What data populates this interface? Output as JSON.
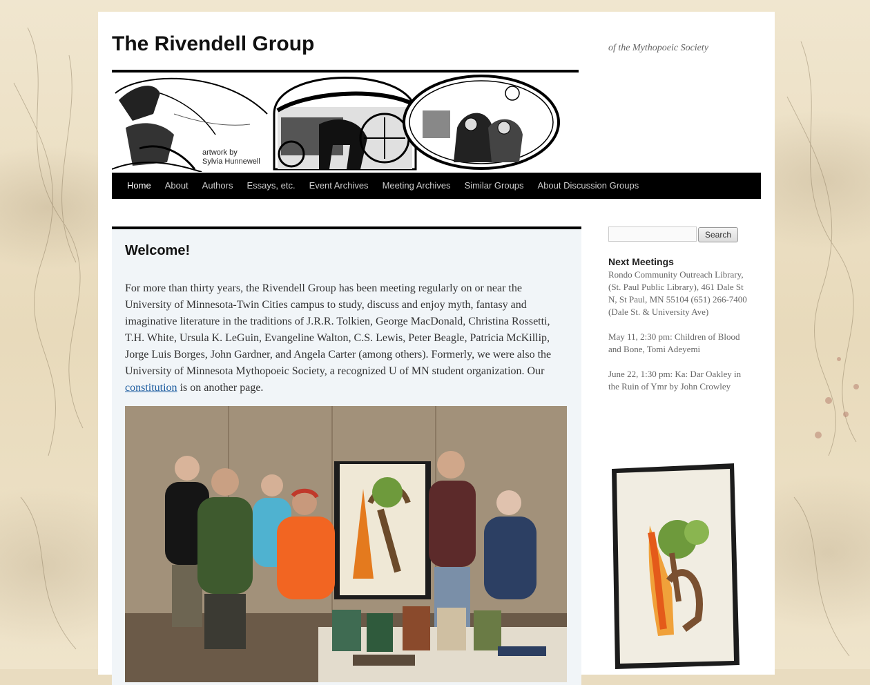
{
  "site": {
    "title": "The Rivendell Group",
    "tagline": "of the Mythopoeic Society",
    "art_credit_line1": "artwork by",
    "art_credit_line2": "Sylvia Hunnewell"
  },
  "nav": {
    "items": [
      "Home",
      "About",
      "Authors",
      "Essays, etc.",
      "Event Archives",
      "Meeting Archives",
      "Similar Groups",
      "About Discussion Groups"
    ],
    "active": "Home"
  },
  "main": {
    "heading": "Welcome!",
    "intro_before_link": "For more than thirty years, the Rivendell Group has been meeting regularly on or near the University of Minnesota-Twin Cities campus to study, discuss and enjoy myth, fantasy and imaginative literature in the traditions of J.R.R. Tolkien, George MacDonald, Christina Rossetti, T.H. White, Ursula K. LeGuin, Evangeline Walton, C.S. Lewis, Peter Beagle, Patricia McKillip, Jorge Luis Borges, John Gardner, and Angela Carter (among others). Formerly, we were also the University of Minnesota Mythopoeic Society, a recognized U of MN student organization. Our ",
    "intro_link": "constitution",
    "intro_after_link": " is on another page."
  },
  "sidebar": {
    "search_placeholder": "",
    "search_button": "Search",
    "widget_title": "Next Meetings",
    "location": "Rondo Community Outreach Library, (St. Paul Public Library), 461 Dale St N, St Paul, MN 55104 (651) 266-7400 (Dale St. & University Ave)",
    "meeting1": "May 11, 2:30 pm: Children of Blood and Bone, Tomi Adeyemi",
    "meeting2": "June 22, 1:30 pm: Ka: Dar Oakley in the Ruin of Ymr by John Crowley"
  },
  "colors": {
    "nav_bg": "#000000",
    "content_bg": "#f1f5f8",
    "link": "#1b5b9f"
  }
}
